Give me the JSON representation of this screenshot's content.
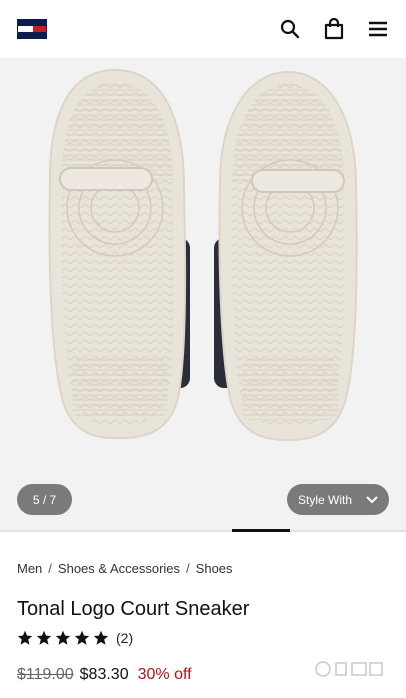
{
  "header": {
    "logo": "tommy-hilfiger-flag-logo",
    "icons": [
      "search-icon",
      "shopping-bag-icon",
      "menu-icon"
    ]
  },
  "gallery": {
    "counter": "5 / 7",
    "style_with_label": "Style With",
    "progress": 0.71
  },
  "breadcrumb": [
    "Men",
    "Shoes & Accessories",
    "Shoes"
  ],
  "product": {
    "title": "Tonal Logo Court Sneaker",
    "rating_stars": 5,
    "review_count": "(2)",
    "old_price": "$119.00",
    "new_price": "$83.30",
    "discount": "30% off"
  },
  "colors": {
    "accent_red": "#cc1c2c",
    "brand_navy": "#0b1d4d",
    "discount_red": "#b5121b",
    "pill_gray": "#7a7a7a"
  }
}
